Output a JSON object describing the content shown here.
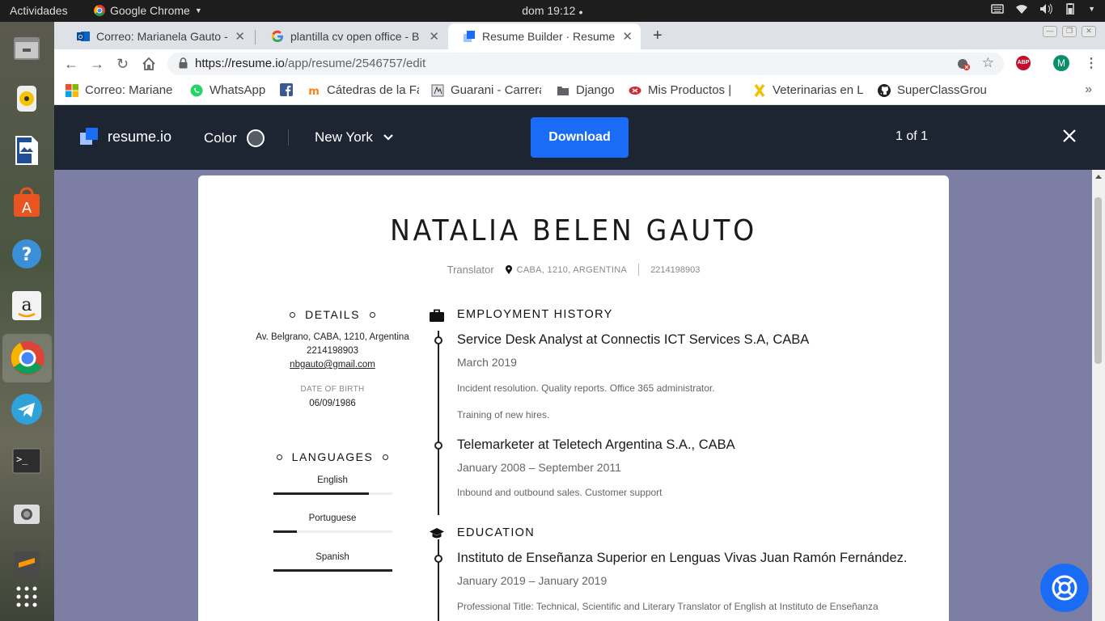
{
  "system": {
    "activities": "Actividades",
    "app_name": "Google Chrome",
    "clock": "dom 19:12",
    "icons": [
      "network-icon",
      "volume-icon",
      "battery-icon",
      "power-menu-icon",
      "keyboard-icon"
    ]
  },
  "dock": {
    "apps": [
      "files-app",
      "rhythmbox-app",
      "libreoffice-impress-app",
      "ubuntu-software-app",
      "help-app",
      "amazon-app",
      "chrome-app",
      "telegram-app",
      "terminal-app",
      "screenshot-app",
      "sublime-app",
      "show-applications"
    ]
  },
  "tabs": [
    {
      "title": "Correo: Marianela Gauto - ",
      "active": false
    },
    {
      "title": "plantilla cv open office - B",
      "active": false
    },
    {
      "title": "Resume Builder · Resume",
      "active": true
    }
  ],
  "toolbar": {
    "url_host": "https://resume.io",
    "url_path": "/app/resume/2546757/edit",
    "profile_initial": "M",
    "abp_label": "ABP"
  },
  "bookmarks": [
    "Correo: Mariane",
    "WhatsApp",
    "",
    "Cátedras de la Fa",
    "Guarani - Carrera",
    "Django",
    "Mis Productos | ",
    "Veterinarias en L",
    "SuperClassGrou"
  ],
  "appbar": {
    "brand": "resume.io",
    "color_label": "Color",
    "template": "New York",
    "download_label": "Download",
    "pager": "1 of 1",
    "colors": {
      "accent": "#1a6cf6",
      "bar": "#1e2532"
    }
  },
  "resume": {
    "name": "NATALIA BELEN GAUTO",
    "title": "Translator",
    "location": "CABA, 1210, ARGENTINA",
    "phone": "2214198903",
    "details": {
      "heading": "DETAILS",
      "address": "Av. Belgrano, CABA, 1210, Argentina",
      "phone": "2214198903",
      "email": "nbgauto@gmail.com",
      "dob_label": "DATE OF BIRTH",
      "dob": "06/09/1986"
    },
    "languages": {
      "heading": "LANGUAGES",
      "items": [
        {
          "name": "English",
          "level": 0.8
        },
        {
          "name": "Portuguese",
          "level": 0.2
        },
        {
          "name": "Spanish",
          "level": 1.0
        }
      ]
    },
    "employment": {
      "heading": "EMPLOYMENT HISTORY",
      "items": [
        {
          "title": "Service Desk Analyst at Connectis ICT Services S.A, CABA",
          "date": "March 2019",
          "desc1": "Incident resolution. Quality reports. Office 365 administrator.",
          "desc2": "Training of new hires."
        },
        {
          "title": "Telemarketer at Teletech Argentina S.A., CABA",
          "date": "January 2008 – September 2011",
          "desc1": "Inbound and outbound sales. Customer support"
        }
      ]
    },
    "education": {
      "heading": "EDUCATION",
      "items": [
        {
          "title": "Instituto de Enseñanza Superior en Lenguas Vivas Juan Ramón Fernández.",
          "date": "January 2019 – January 2019",
          "desc1": "Professional Title: Technical, Scientific and Literary Translator of English at Instituto de Enseñanza"
        }
      ]
    }
  }
}
